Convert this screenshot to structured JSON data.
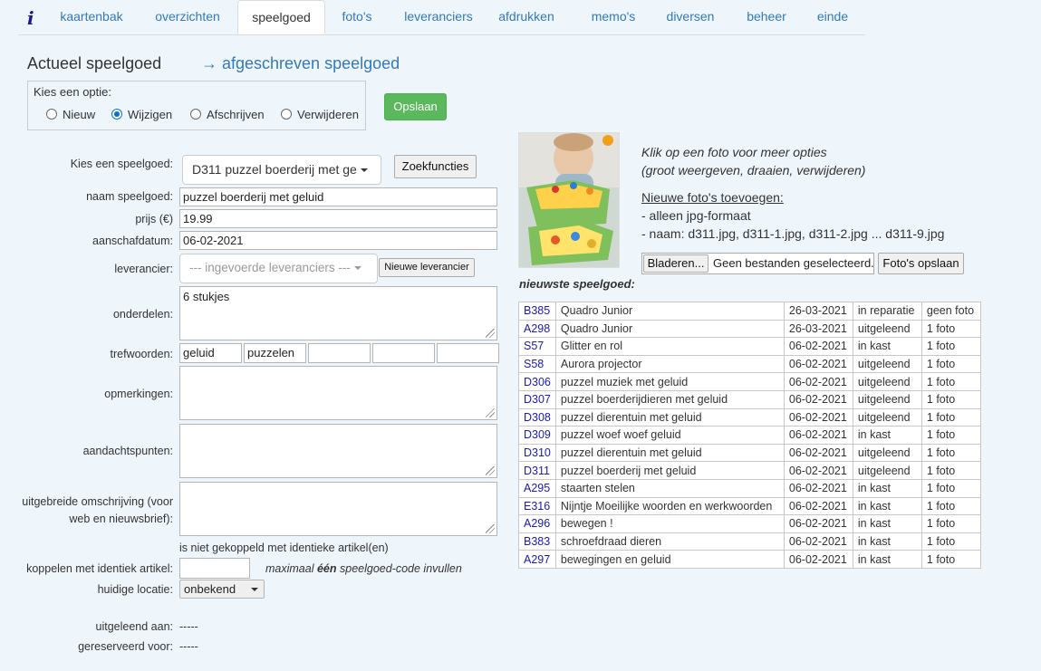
{
  "nav": {
    "logo": "i",
    "tabs": [
      "kaartenbak",
      "overzichten",
      "speelgoed",
      "foto's",
      "leveranciers",
      "afdrukken",
      "memo's",
      "diversen",
      "beheer",
      "einde"
    ],
    "active": "speelgoed"
  },
  "header": {
    "title": "Actueel speelgoed",
    "link": "→ afgeschreven speelgoed"
  },
  "options": {
    "legend": "Kies een optie:",
    "radios": [
      "Nieuw",
      "Wijzigen",
      "Afschrijven",
      "Verwijderen"
    ],
    "selected": "Wijzigen",
    "save_label": "Opslaan"
  },
  "form": {
    "kies_label": "Kies een speelgoed:",
    "kies_value": "D311 puzzel boerderij met ge",
    "zoek_label": "Zoekfuncties",
    "naam_label": "naam speelgoed:",
    "naam_value": "puzzel  boerderij met geluid",
    "prijs_label": "prijs (€)",
    "prijs_value": "19.99",
    "datum_label": "aanschafdatum:",
    "datum_value": "06-02-2021",
    "lev_label": "leverancier:",
    "lev_value": "--- ingevoerde leveranciers ---",
    "lev_new": "Nieuwe leverancier",
    "onderdelen_label": "onderdelen:",
    "onderdelen_value": "6 stukjes",
    "trefwoorden_label": "trefwoorden:",
    "trefwoorden": [
      "geluid",
      "puzzelen",
      "",
      "",
      ""
    ],
    "opmerkingen_label": "opmerkingen:",
    "aandacht_label": "aandachtspunten:",
    "omschrijving_label_1": "uitgebreide omschrijving (voor",
    "omschrijving_label_2": "web en nieuwsbrief):",
    "niet_gekoppeld": "is niet gekoppeld met identieke artikel(en)",
    "koppelen_label": "koppelen met identiek artikel:",
    "koppelen_note_1": "maximaal ",
    "koppelen_note_bold": "één",
    "koppelen_note_2": " speelgoed-code invullen",
    "locatie_label": "huidige locatie:",
    "locatie_value": "onbekend",
    "uitgeleend_label": "uitgeleend aan:",
    "uitgeleend_value": "-----",
    "gereserveerd_label": "gereserveerd voor:",
    "gereserveerd_value": "-----"
  },
  "photos": {
    "hint_1": "Klik op een foto voor meer opties",
    "hint_2": "(groot weergeven, draaien, verwijderen)",
    "add_title": "Nieuwe foto's toevoegen:",
    "rule_1": "- alleen jpg-formaat",
    "rule_2": "- naam: d311.jpg, d311-1.jpg, d311-2.jpg ... d311-9.jpg",
    "browse_label": "Bladeren...",
    "no_file": "Geen bestanden geselecteerd.",
    "save_photos": "Foto's opslaan"
  },
  "newest": {
    "title": "nieuwste speelgoed:",
    "rows": [
      [
        "B385",
        "Quadro Junior",
        "26-03-2021",
        "in reparatie",
        "geen foto"
      ],
      [
        "A298",
        "Quadro Junior",
        "26-03-2021",
        "uitgeleend",
        "1 foto"
      ],
      [
        "S57",
        "Glitter en rol",
        "06-02-2021",
        "in kast",
        "1 foto"
      ],
      [
        "S58",
        "Aurora projector",
        "06-02-2021",
        "uitgeleend",
        "1 foto"
      ],
      [
        "D306",
        "puzzel muziek met geluid",
        "06-02-2021",
        "uitgeleend",
        "1 foto"
      ],
      [
        "D307",
        "puzzel boerderijdieren met geluid",
        "06-02-2021",
        "uitgeleend",
        "1 foto"
      ],
      [
        "D308",
        "puzzel dierentuin met geluid",
        "06-02-2021",
        "uitgeleend",
        "1 foto"
      ],
      [
        "D309",
        "puzzel woef woef geluid",
        "06-02-2021",
        "in kast",
        "1 foto"
      ],
      [
        "D310",
        "puzzel dierentuin met geluid",
        "06-02-2021",
        "uitgeleend",
        "1 foto"
      ],
      [
        "D311",
        "puzzel boerderij met geluid",
        "06-02-2021",
        "uitgeleend",
        "1 foto"
      ],
      [
        "A295",
        "staarten stelen",
        "06-02-2021",
        "in kast",
        "1 foto"
      ],
      [
        "E316",
        "Nijntje Moeilijke woorden en werkwoorden",
        "06-02-2021",
        "in kast",
        "1 foto"
      ],
      [
        "A296",
        "bewegen !",
        "06-02-2021",
        "in kast",
        "1 foto"
      ],
      [
        "B383",
        "schroefdraad dieren",
        "06-02-2021",
        "in kast",
        "1 foto"
      ],
      [
        "A297",
        "bewegingen en geluid",
        "06-02-2021",
        "in kast",
        "1 foto"
      ]
    ]
  },
  "colors": {
    "accent": "#337ab7",
    "save_green": "#5cb85c",
    "link_code": "#1a1ab8"
  }
}
